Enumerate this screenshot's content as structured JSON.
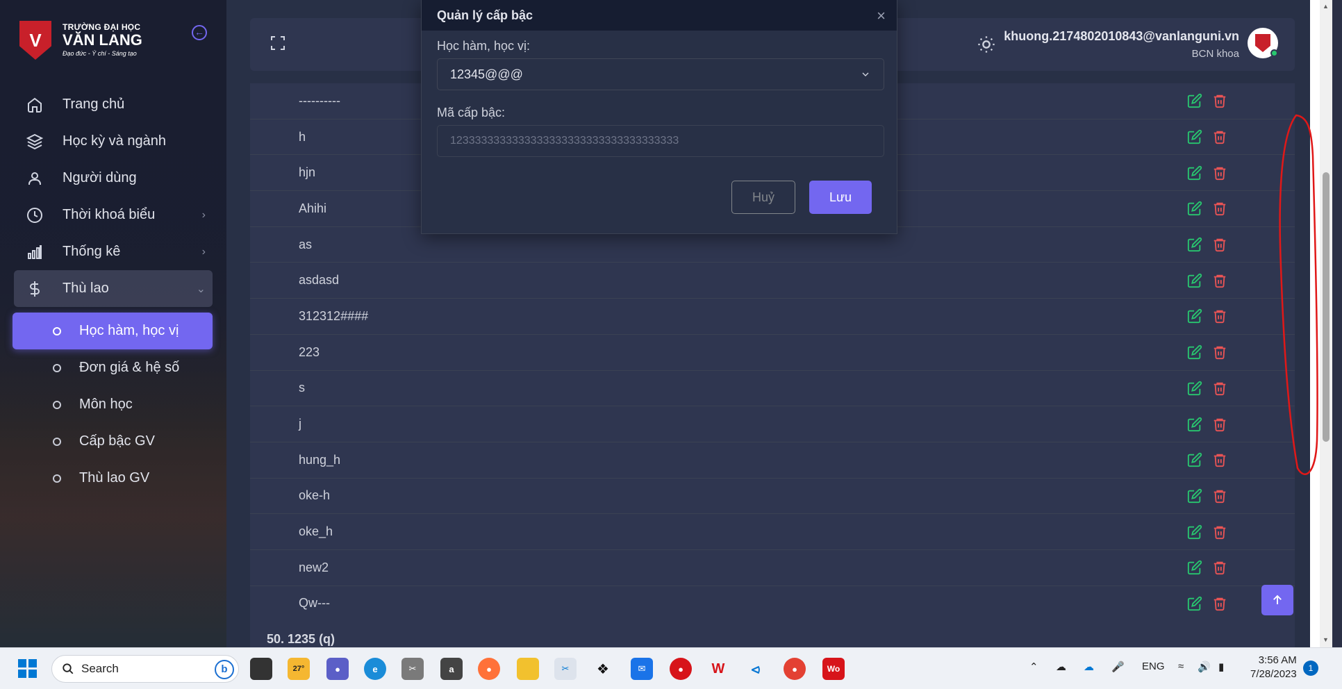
{
  "brand": {
    "line1": "TRƯỜNG ĐẠI HỌC",
    "line2": "VĂN LANG",
    "slogan": "Đạo đức - Ý chí - Sáng tạo",
    "color": "#c8202a"
  },
  "sidebar": {
    "items": [
      {
        "label": "Trang chủ",
        "icon": "home-icon"
      },
      {
        "label": "Học kỳ và ngành",
        "icon": "layers-icon"
      },
      {
        "label": "Người dùng",
        "icon": "user-icon"
      },
      {
        "label": "Thời khoá biểu",
        "icon": "clock-icon"
      },
      {
        "label": "Thống kê",
        "icon": "bar-chart-icon"
      },
      {
        "label": "Thù lao",
        "icon": "dollar-icon"
      }
    ],
    "sub_items": [
      {
        "label": "Học hàm, học vị",
        "active": true
      },
      {
        "label": "Đơn giá & hệ số"
      },
      {
        "label": "Môn học"
      },
      {
        "label": "Cấp bậc GV"
      },
      {
        "label": "Thù lao GV"
      }
    ]
  },
  "header": {
    "email": "khuong.2174802010843@vanlanguni.vn",
    "role": "BCN khoa"
  },
  "table": {
    "rows": [
      "----------",
      "h",
      "hjn",
      "Ahihi",
      "as",
      "asdasd",
      "312312####",
      "223",
      "s",
      "j",
      "hung_h",
      "oke-h",
      "oke_h",
      "new2",
      "Qw---"
    ],
    "footer": "50. 1235 (q)"
  },
  "modal": {
    "title": "Quản lý cấp bậc",
    "field1_label": "Học hàm, học vị:",
    "field1_value": "12345@@@",
    "field2_label": "Mã cấp bậc:",
    "field2_placeholder": "1233333333333333333333333333333333333",
    "cancel_label": "Huỷ",
    "save_label": "Lưu"
  },
  "colors": {
    "accent": "#7367f0",
    "edit": "#28c76f",
    "delete": "#ea5455",
    "annotation": "#e01818"
  },
  "taskbar": {
    "search_label": "Search",
    "weather": "27°",
    "language": "ENG",
    "time": "3:56 AM",
    "date": "7/28/2023",
    "notifications": "1"
  }
}
